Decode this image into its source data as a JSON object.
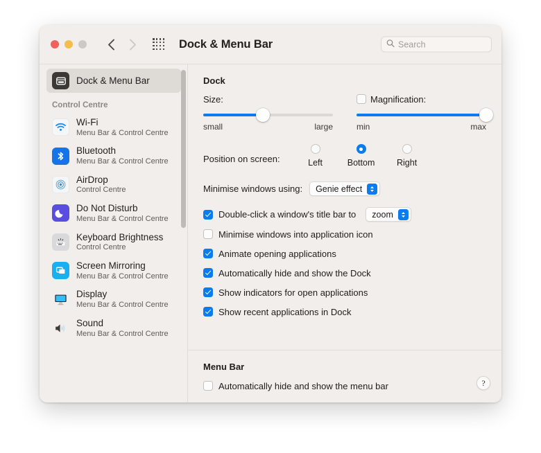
{
  "window": {
    "title": "Dock & Menu Bar",
    "traffic_lights": [
      "close",
      "minimise",
      "zoom"
    ],
    "back_label": "Back",
    "forward_label": "Forward",
    "grid_label": "Show All"
  },
  "search": {
    "placeholder": "Search",
    "value": ""
  },
  "sidebar": {
    "top_item": {
      "title": "Dock & Menu Bar",
      "icon": "dock-icon",
      "selected": true
    },
    "group_header": "Control Centre",
    "items": [
      {
        "title": "Wi-Fi",
        "subtitle": "Menu Bar & Control Centre",
        "icon": "wifi-icon"
      },
      {
        "title": "Bluetooth",
        "subtitle": "Menu Bar & Control Centre",
        "icon": "bluetooth-icon"
      },
      {
        "title": "AirDrop",
        "subtitle": "Control Centre",
        "icon": "airdrop-icon"
      },
      {
        "title": "Do Not Disturb",
        "subtitle": "Menu Bar & Control Centre",
        "icon": "moon-icon"
      },
      {
        "title": "Keyboard Brightness",
        "subtitle": "Control Centre",
        "icon": "keyboard-icon"
      },
      {
        "title": "Screen Mirroring",
        "subtitle": "Menu Bar & Control Centre",
        "icon": "screen-mirroring-icon"
      },
      {
        "title": "Display",
        "subtitle": "Menu Bar & Control Centre",
        "icon": "display-icon"
      },
      {
        "title": "Sound",
        "subtitle": "Menu Bar & Control Centre",
        "icon": "sound-icon"
      }
    ]
  },
  "dock": {
    "heading": "Dock",
    "size": {
      "label": "Size:",
      "min_label": "small",
      "max_label": "large",
      "value_percent": 46
    },
    "magnification": {
      "label": "Magnification:",
      "checked": false,
      "min_label": "min",
      "max_label": "max",
      "value_percent": 100
    },
    "position": {
      "label": "Position on screen:",
      "options": [
        "Left",
        "Bottom",
        "Right"
      ],
      "selected": "Bottom"
    },
    "minimise_effect": {
      "label": "Minimise windows using:",
      "value": "Genie effect"
    },
    "double_click": {
      "label": "Double-click a window's title bar to",
      "checked": true,
      "value": "zoom"
    },
    "checkboxes": [
      {
        "label": "Minimise windows into application icon",
        "checked": false
      },
      {
        "label": "Animate opening applications",
        "checked": true
      },
      {
        "label": "Automatically hide and show the Dock",
        "checked": true
      },
      {
        "label": "Show indicators for open applications",
        "checked": true
      },
      {
        "label": "Show recent applications in Dock",
        "checked": true
      }
    ]
  },
  "menu_bar": {
    "heading": "Menu Bar",
    "auto_hide": {
      "label": "Automatically hide and show the menu bar",
      "checked": false
    }
  },
  "help": {
    "label": "?"
  },
  "colors": {
    "accent": "#0a7cf0",
    "window_bg": "#f2eeeb",
    "selected_row": "#dedad6",
    "close": "#f0605c",
    "minimise": "#f5bd4f",
    "zoom": "#ccc9c6"
  }
}
